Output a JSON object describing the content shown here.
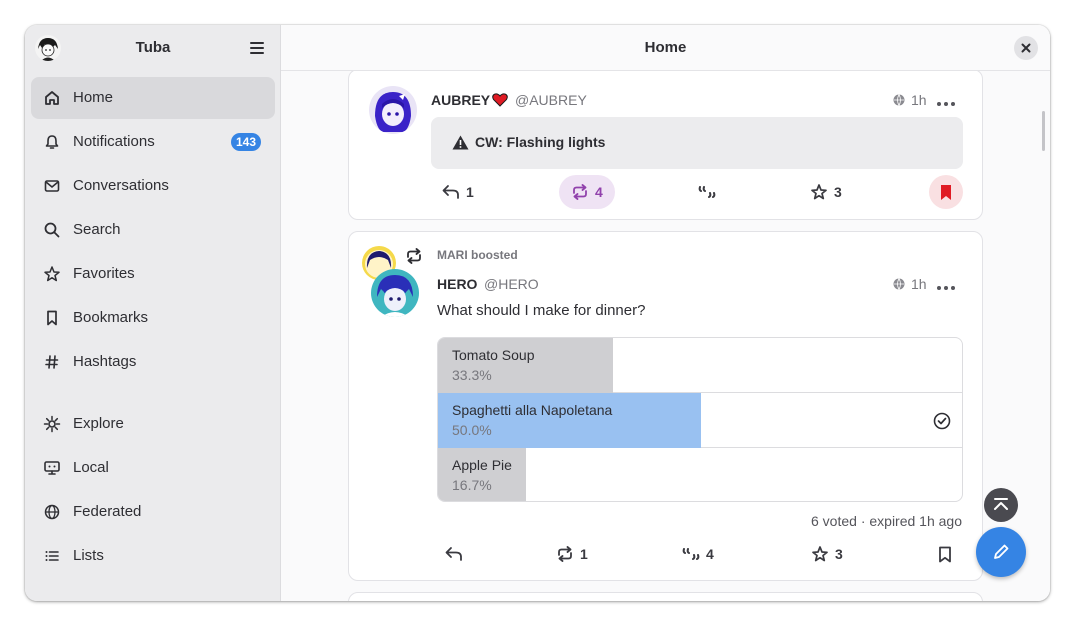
{
  "app": {
    "title": "Tuba"
  },
  "header": {
    "title": "Home"
  },
  "sidebar": {
    "items": [
      {
        "label": "Home",
        "icon": "home-icon",
        "active": true
      },
      {
        "label": "Notifications",
        "icon": "bell-icon",
        "badge": "143"
      },
      {
        "label": "Conversations",
        "icon": "mail-icon"
      },
      {
        "label": "Search",
        "icon": "search-icon"
      },
      {
        "label": "Favorites",
        "icon": "star-icon"
      },
      {
        "label": "Bookmarks",
        "icon": "bookmark-icon"
      },
      {
        "label": "Hashtags",
        "icon": "hashtag-icon"
      },
      {
        "label": "Explore",
        "icon": "explore-icon"
      },
      {
        "label": "Local",
        "icon": "local-icon"
      },
      {
        "label": "Federated",
        "icon": "globe-icon"
      },
      {
        "label": "Lists",
        "icon": "list-icon"
      }
    ]
  },
  "posts": [
    {
      "author_name": "AUBREY",
      "author_emoji": "heart-emoji",
      "handle": "@AUBREY",
      "time": "1h",
      "visibility_icon": "globe-icon",
      "content_warning": "CW: Flashing lights",
      "replies": "1",
      "boosts": "4",
      "boosted_by_me": true,
      "favorites": "3",
      "bookmarked": true
    },
    {
      "boosted_by": "MARI boosted",
      "author_name": "HERO",
      "handle": "@HERO",
      "time": "1h",
      "visibility_icon": "globe-icon",
      "text": "What should I make for dinner?",
      "poll": {
        "options": [
          {
            "label": "Tomato Soup",
            "percent": "33.3%",
            "fraction": 0.333,
            "mine": false
          },
          {
            "label": "Spaghetti alla Napoletana",
            "percent": "50.0%",
            "fraction": 0.5,
            "mine": true
          },
          {
            "label": "Apple Pie",
            "percent": "16.7%",
            "fraction": 0.167,
            "mine": false
          }
        ],
        "footer": "6 voted · expired 1h ago"
      },
      "replies": "",
      "boosts": "1",
      "quotes": "4",
      "favorites": "3",
      "bookmarked": false
    }
  ],
  "colors": {
    "accent": "#3584e4",
    "boost": "#9141ac",
    "bookmark": "#e01b24",
    "poll_mine": "#99c1f1",
    "poll_other": "#cfcfd2"
  }
}
